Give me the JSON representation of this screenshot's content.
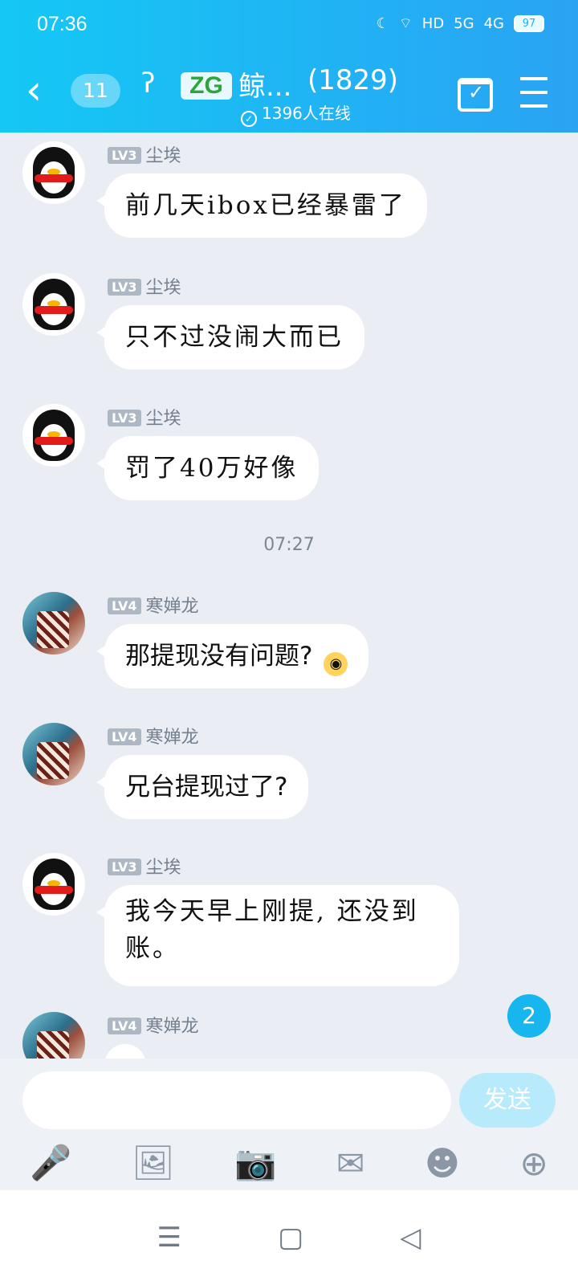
{
  "status_bar": {
    "time": "07:36",
    "signal_hd": "HD",
    "net_5g": "5G",
    "net_4g": "4G",
    "battery": "97"
  },
  "header": {
    "back_glyph": "‹",
    "unread": "11",
    "logo": "ZG",
    "title": "鲸...",
    "member_count": "(1829)",
    "online": "1396人在线"
  },
  "messages": [
    {
      "level": "LV3",
      "name": "尘埃",
      "text": "前几天ibox已经暴雷了"
    },
    {
      "level": "LV3",
      "name": "尘埃",
      "text": "只不过没闹大而已"
    },
    {
      "level": "LV3",
      "name": "尘埃",
      "text": "罚了40万好像"
    },
    {
      "level": "LV4",
      "name": "寒婵龙",
      "text": "那提现没有问题?"
    },
    {
      "level": "LV4",
      "name": "寒婵龙",
      "text": "兄台提现过了?"
    },
    {
      "level": "LV3",
      "name": "尘埃",
      "text": "我今天早上刚提, 还没到账。"
    },
    {
      "level": "LV4",
      "name": "寒婵龙",
      "text": ""
    }
  ],
  "time_separator": "07:27",
  "new_messages_badge": "2",
  "composer": {
    "send_label": "发送",
    "input_placeholder": ""
  },
  "toolbar": {
    "voice": "🎤",
    "image": "🖼",
    "camera": "📷",
    "redpacket": "✉",
    "emoji": "☻",
    "more": "⊕"
  },
  "nav": {
    "menu": "☰",
    "home": "▢",
    "back": "◁"
  }
}
